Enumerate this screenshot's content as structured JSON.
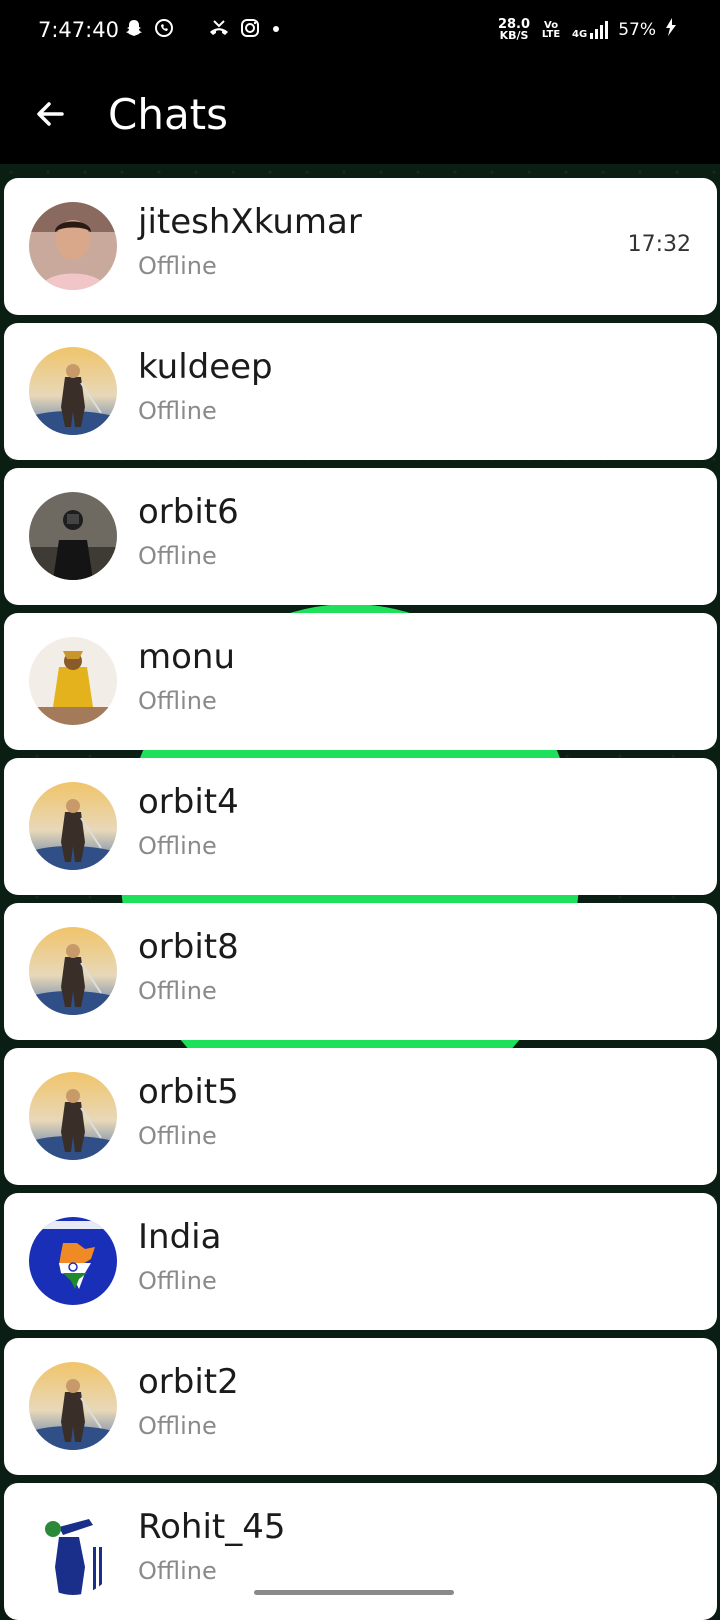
{
  "status_bar": {
    "time": "7:47:40",
    "net_speed_value": "28.0",
    "net_speed_unit": "KB/S",
    "volte": "Vo LTE",
    "network": "4G",
    "battery": "57%",
    "left_icons": [
      "snapchat-icon",
      "whatsapp-icon",
      "missed-call-icon",
      "instagram-icon",
      "dot-icon"
    ]
  },
  "header": {
    "title": "Chats",
    "back_icon": "arrow-left-icon"
  },
  "chats": [
    {
      "name": "jiteshXkumar",
      "status": "Offline",
      "time": "17:32",
      "avatar": "person-photo"
    },
    {
      "name": "kuldeep",
      "status": "Offline",
      "time": "",
      "avatar": "warrior-art"
    },
    {
      "name": "orbit6",
      "status": "Offline",
      "time": "",
      "avatar": "camera-person-photo"
    },
    {
      "name": "monu",
      "status": "Offline",
      "time": "",
      "avatar": "deity-photo"
    },
    {
      "name": "orbit4",
      "status": "Offline",
      "time": "",
      "avatar": "warrior-art"
    },
    {
      "name": "orbit8",
      "status": "Offline",
      "time": "",
      "avatar": "warrior-art"
    },
    {
      "name": "orbit5",
      "status": "Offline",
      "time": "",
      "avatar": "warrior-art"
    },
    {
      "name": "India",
      "status": "Offline",
      "time": "",
      "avatar": "india-map"
    },
    {
      "name": "orbit2",
      "status": "Offline",
      "time": "",
      "avatar": "warrior-art"
    },
    {
      "name": "Rohit_45",
      "status": "Offline",
      "time": "",
      "avatar": "cricket-art"
    }
  ],
  "colors": {
    "app_bar": "#000000",
    "background": "#0b1e13",
    "accent_green": "#1ee05a",
    "card": "#ffffff",
    "name_text": "#1b1b1b",
    "status_text": "#8a8a8a"
  }
}
